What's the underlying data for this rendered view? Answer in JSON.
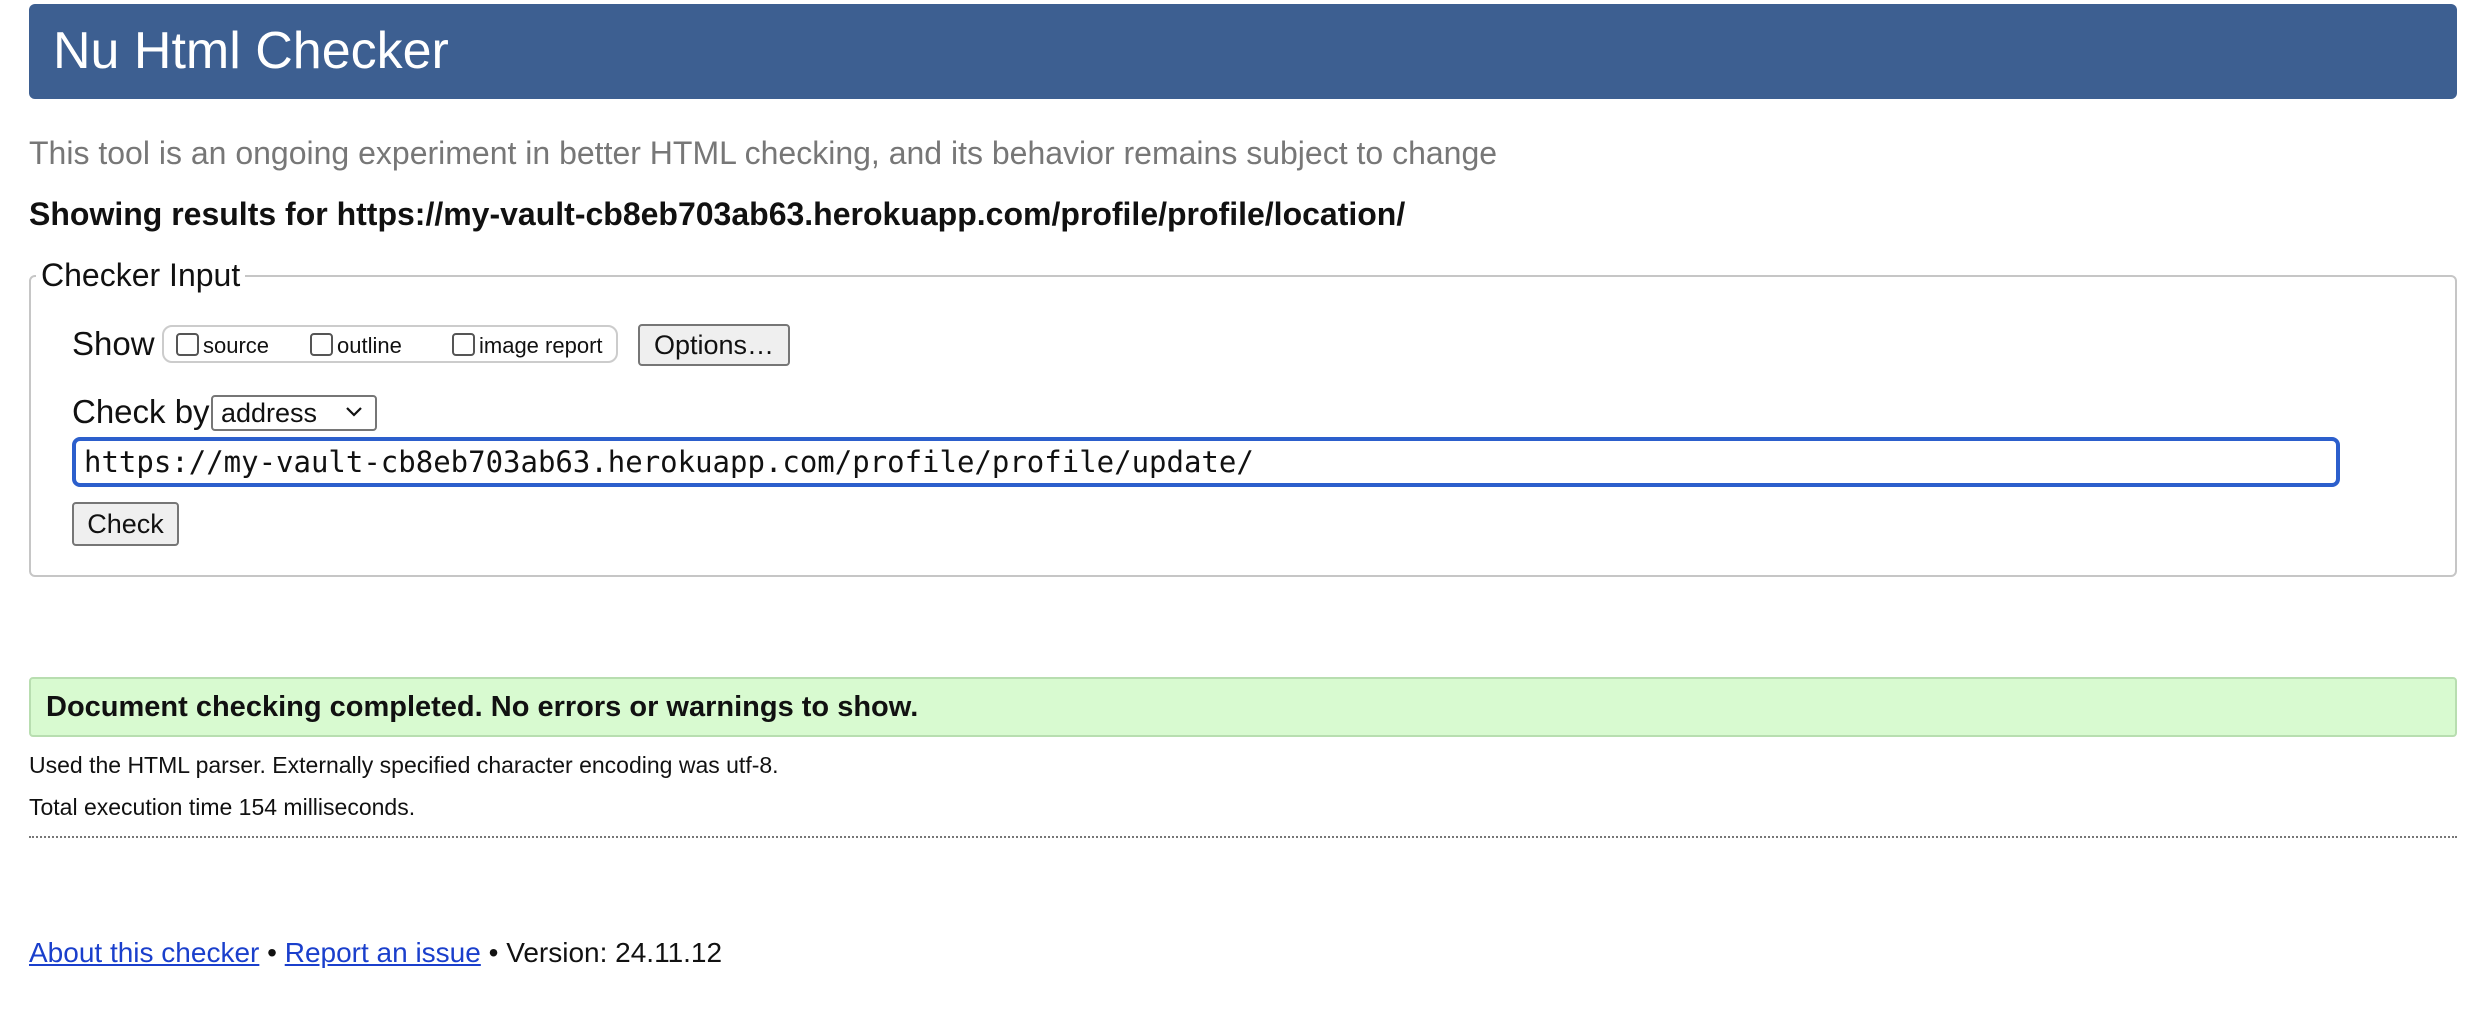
{
  "header": {
    "title": "Nu Html Checker"
  },
  "tagline": "This tool is an ongoing experiment in better HTML checking, and its behavior remains subject to change",
  "results_heading": "Showing results for https://my-vault-cb8eb703ab63.herokuapp.com/profile/profile/location/",
  "checker_input": {
    "legend": "Checker Input",
    "show_label": "Show",
    "show_options": [
      {
        "label": "source",
        "checked": false
      },
      {
        "label": "outline",
        "checked": false
      },
      {
        "label": "image report",
        "checked": false
      }
    ],
    "options_button": "Options…",
    "check_by_label": "Check by",
    "check_by_selected": "address",
    "url_value": "https://my-vault-cb8eb703ab63.herokuapp.com/profile/profile/update/",
    "check_button": "Check"
  },
  "result": {
    "success_message": "Document checking completed. No errors or warnings to show.",
    "parser_info": "Used the HTML parser. Externally specified character encoding was utf-8.",
    "execution_time": "Total execution time 154 milliseconds."
  },
  "footer": {
    "about_link": "About this checker",
    "separator": "•",
    "report_link": "Report an issue",
    "version_text": "Version: 24.11.12"
  },
  "colors": {
    "header_bg": "#3d5f91",
    "success_bg": "#d8fad0",
    "link": "#1a3fcc",
    "input_focus": "#2c5fcc"
  },
  "icons": {
    "select_arrow": "chevron-down-icon"
  }
}
